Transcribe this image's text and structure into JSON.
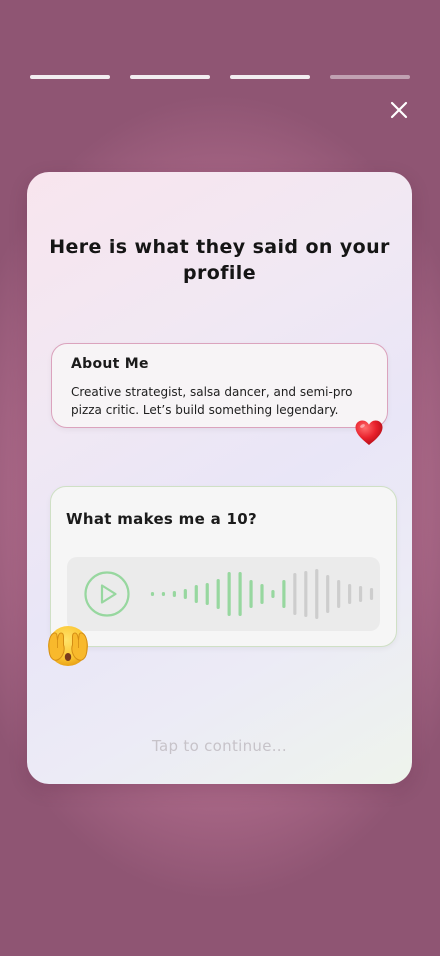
{
  "progress": {
    "total_segments": 4,
    "completed_segments": 3
  },
  "colors": {
    "accent_green": "#97d79f",
    "accent_pink": "#dba3bd",
    "heart_red": "#e8202b"
  },
  "icons": {
    "close": "close-icon",
    "play": "play-icon",
    "heart": "heart-emoji",
    "face": "face-with-hand-over-eyes-emoji"
  },
  "card": {
    "title": "Here is what they said on your profile",
    "about": {
      "heading": "About Me",
      "body": "Creative strategist, salsa dancer, and semi-pro pizza critic. Let’s build something legendary."
    },
    "voice_prompt": {
      "heading": "What makes me a 10?",
      "played_fraction": 0.62
    },
    "footer": "Tap to continue..."
  }
}
